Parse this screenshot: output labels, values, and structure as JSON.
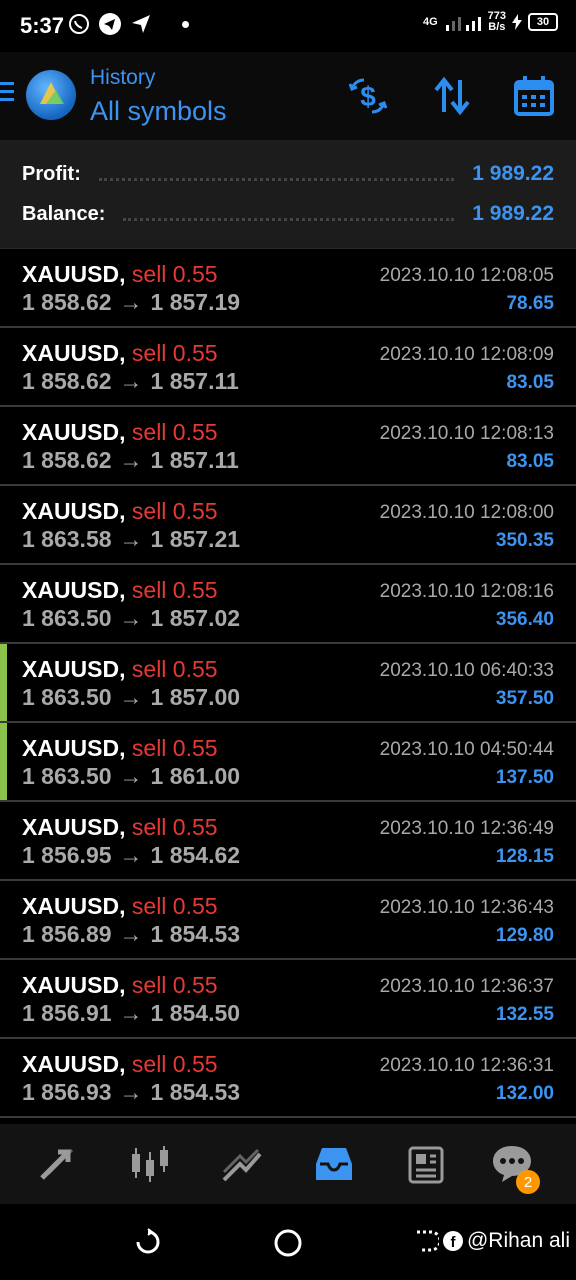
{
  "status_bar": {
    "time": "5:37",
    "net_speed_value": "773",
    "net_speed_unit": "B/s",
    "signal_label": "4G",
    "battery": "30"
  },
  "header": {
    "subtitle": "History",
    "title": "All symbols"
  },
  "summary": {
    "profit_label": "Profit:",
    "profit_value": "1 989.22",
    "balance_label": "Balance:",
    "balance_value": "1 989.22"
  },
  "trades": [
    {
      "symbol": "XAUUSD,",
      "type": "sell 0.55",
      "open": "1 858.62",
      "close": "1 857.19",
      "time": "2023.10.10 12:08:05",
      "profit": "78.65",
      "marked": false
    },
    {
      "symbol": "XAUUSD,",
      "type": "sell 0.55",
      "open": "1 858.62",
      "close": "1 857.11",
      "time": "2023.10.10 12:08:09",
      "profit": "83.05",
      "marked": false
    },
    {
      "symbol": "XAUUSD,",
      "type": "sell 0.55",
      "open": "1 858.62",
      "close": "1 857.11",
      "time": "2023.10.10 12:08:13",
      "profit": "83.05",
      "marked": false
    },
    {
      "symbol": "XAUUSD,",
      "type": "sell 0.55",
      "open": "1 863.58",
      "close": "1 857.21",
      "time": "2023.10.10 12:08:00",
      "profit": "350.35",
      "marked": false
    },
    {
      "symbol": "XAUUSD,",
      "type": "sell 0.55",
      "open": "1 863.50",
      "close": "1 857.02",
      "time": "2023.10.10 12:08:16",
      "profit": "356.40",
      "marked": false
    },
    {
      "symbol": "XAUUSD,",
      "type": "sell 0.55",
      "open": "1 863.50",
      "close": "1 857.00",
      "time": "2023.10.10 06:40:33",
      "profit": "357.50",
      "marked": true
    },
    {
      "symbol": "XAUUSD,",
      "type": "sell 0.55",
      "open": "1 863.50",
      "close": "1 861.00",
      "time": "2023.10.10 04:50:44",
      "profit": "137.50",
      "marked": true
    },
    {
      "symbol": "XAUUSD,",
      "type": "sell 0.55",
      "open": "1 856.95",
      "close": "1 854.62",
      "time": "2023.10.10 12:36:49",
      "profit": "128.15",
      "marked": false
    },
    {
      "symbol": "XAUUSD,",
      "type": "sell 0.55",
      "open": "1 856.89",
      "close": "1 854.53",
      "time": "2023.10.10 12:36:43",
      "profit": "129.80",
      "marked": false
    },
    {
      "symbol": "XAUUSD,",
      "type": "sell 0.55",
      "open": "1 856.91",
      "close": "1 854.50",
      "time": "2023.10.10 12:36:37",
      "profit": "132.55",
      "marked": false
    },
    {
      "symbol": "XAUUSD,",
      "type": "sell 0.55",
      "open": "1 856.93",
      "close": "1 854.53",
      "time": "2023.10.10 12:36:31",
      "profit": "132.00",
      "marked": false
    }
  ],
  "trade_arrow": "→",
  "bottom_nav": {
    "chat_badge": "2",
    "items": [
      "quotes-icon",
      "chart-icon",
      "trade-icon",
      "history-icon",
      "news-icon",
      "chat-icon"
    ]
  },
  "watermark": {
    "text": "@Rihan ali"
  },
  "colors": {
    "accent": "#3d93f0",
    "sell": "#e53935",
    "marker": "#8bc34a",
    "badge": "#ff9800"
  }
}
